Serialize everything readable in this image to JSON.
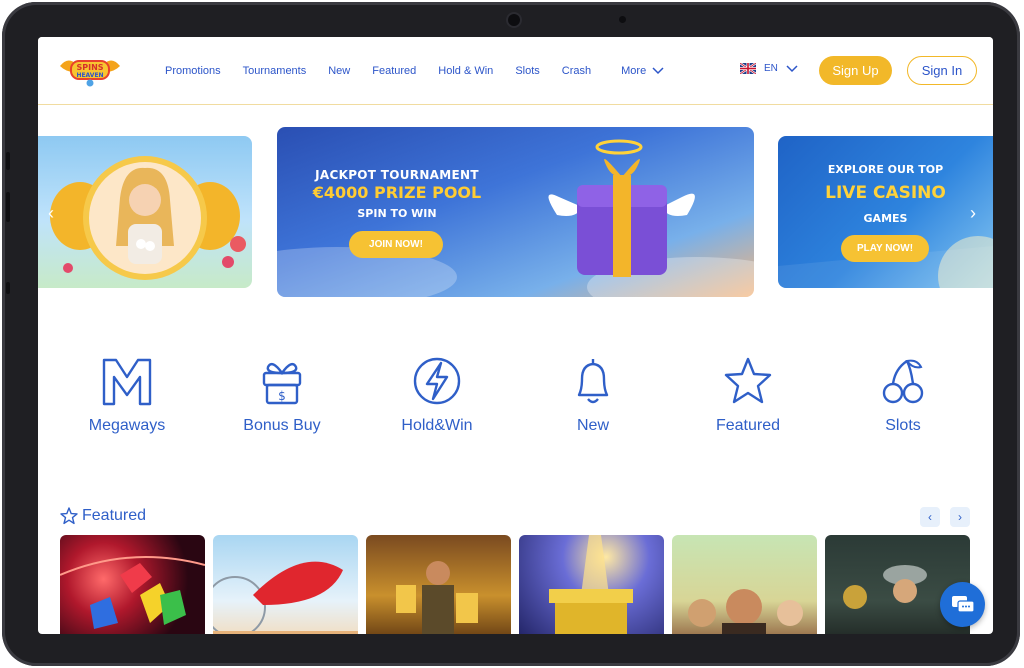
{
  "brand": {
    "logo_text_top": "SPINS",
    "logo_text_bottom": "HEAVEN"
  },
  "nav": {
    "items": [
      "Promotions",
      "Tournaments",
      "New",
      "Featured",
      "Hold & Win",
      "Slots",
      "Crash"
    ],
    "more_label": "More"
  },
  "language": {
    "code": "EN",
    "flag": "uk-flag-icon"
  },
  "auth": {
    "signup_label": "Sign Up",
    "signin_label": "Sign In"
  },
  "banners": {
    "middle": {
      "line1": "JACKPOT TOURNAMENT",
      "line2": "€4000 PRIZE POOL",
      "line3": "SPIN TO WIN",
      "cta": "JOIN NOW!"
    },
    "right": {
      "line1": "EXPLORE OUR TOP",
      "line2": "LIVE CASINO",
      "line3": "GAMES",
      "cta": "PLAY NOW!"
    }
  },
  "categories": [
    {
      "label": "Megaways",
      "icon": "megaways-icon"
    },
    {
      "label": "Bonus Buy",
      "icon": "gift-dollar-icon"
    },
    {
      "label": "Hold&Win",
      "icon": "lightning-icon"
    },
    {
      "label": "New",
      "icon": "bell-icon"
    },
    {
      "label": "Featured",
      "icon": "star-icon"
    },
    {
      "label": "Slots",
      "icon": "cherries-icon"
    }
  ],
  "featured": {
    "title": "Featured",
    "prev": "‹",
    "next": "›"
  },
  "colors": {
    "accent": "#f2b829",
    "link": "#2c55c9",
    "chat": "#1f6ed8"
  }
}
